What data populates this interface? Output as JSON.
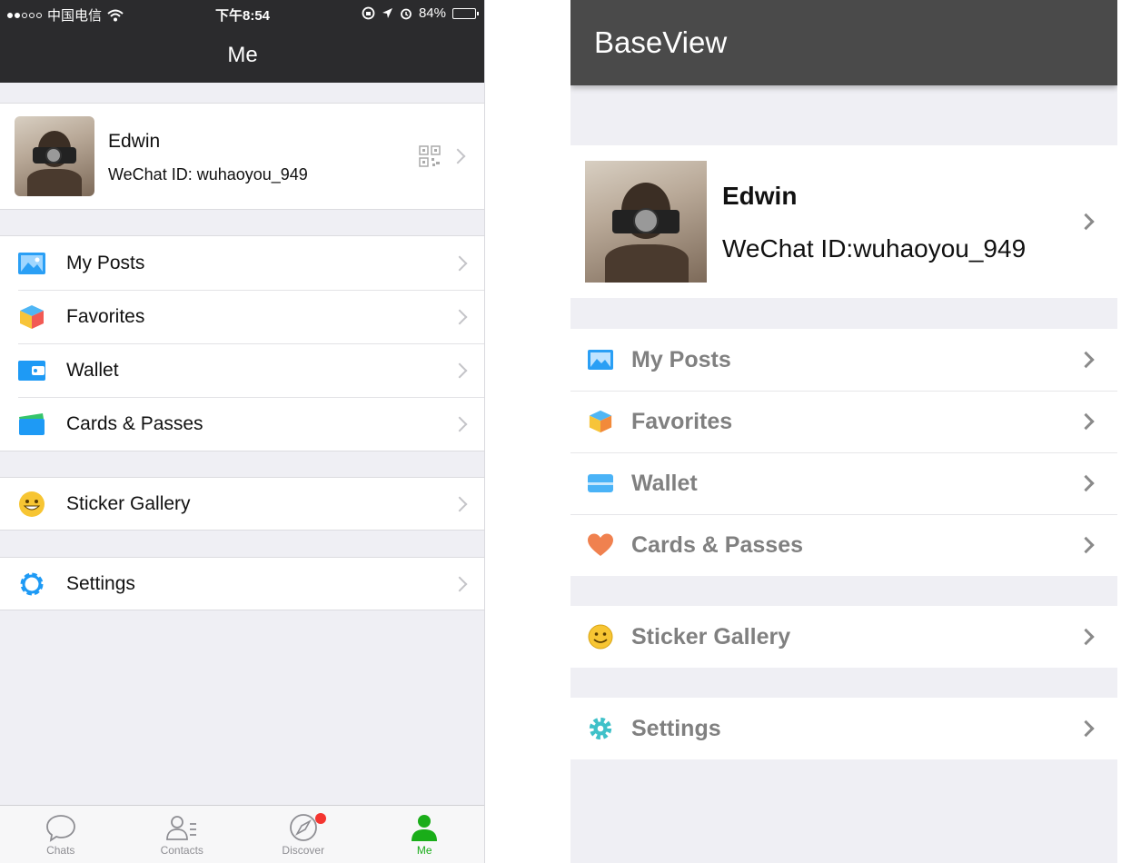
{
  "ios": {
    "status": {
      "carrier": "中国电信",
      "time": "下午8:54",
      "battery": "84%",
      "battery_level": 0.84
    },
    "title": "Me",
    "profile": {
      "name": "Edwin",
      "wechat_id": "WeChat ID: wuhaoyou_949"
    },
    "groups": [
      [
        {
          "label": "My Posts",
          "icon": "photo-album-icon"
        },
        {
          "label": "Favorites",
          "icon": "cube-icon"
        },
        {
          "label": "Wallet",
          "icon": "wallet-icon"
        },
        {
          "label": "Cards & Passes",
          "icon": "card-icon"
        }
      ],
      [
        {
          "label": "Sticker Gallery",
          "icon": "smiley-icon"
        }
      ],
      [
        {
          "label": "Settings",
          "icon": "gear-icon"
        }
      ]
    ],
    "tabs": [
      {
        "label": "Chats",
        "icon": "chat-bubble-icon"
      },
      {
        "label": "Contacts",
        "icon": "contacts-icon"
      },
      {
        "label": "Discover",
        "icon": "compass-icon"
      },
      {
        "label": "Me",
        "icon": "person-icon"
      }
    ],
    "active_tab": "Me"
  },
  "android": {
    "title": "BaseView",
    "profile": {
      "name": "Edwin",
      "wechat_id": "WeChat ID:wuhaoyou_949"
    },
    "groups": [
      [
        {
          "label": "My Posts",
          "icon": "photo-album-icon"
        },
        {
          "label": "Favorites",
          "icon": "cube-icon"
        },
        {
          "label": "Wallet",
          "icon": "wallet-icon"
        },
        {
          "label": "Cards & Passes",
          "icon": "heart-icon"
        }
      ],
      [
        {
          "label": "Sticker Gallery",
          "icon": "smiley-icon"
        }
      ],
      [
        {
          "label": "Settings",
          "icon": "gear-icon"
        }
      ]
    ]
  },
  "colors": {
    "ios_bar": "#2b2b2d",
    "android_bar": "#4a4a4a",
    "background": "#efeff4",
    "wechat_green": "#1aad19",
    "badge_red": "#f43530",
    "icon_blue": "#1e9af5"
  }
}
